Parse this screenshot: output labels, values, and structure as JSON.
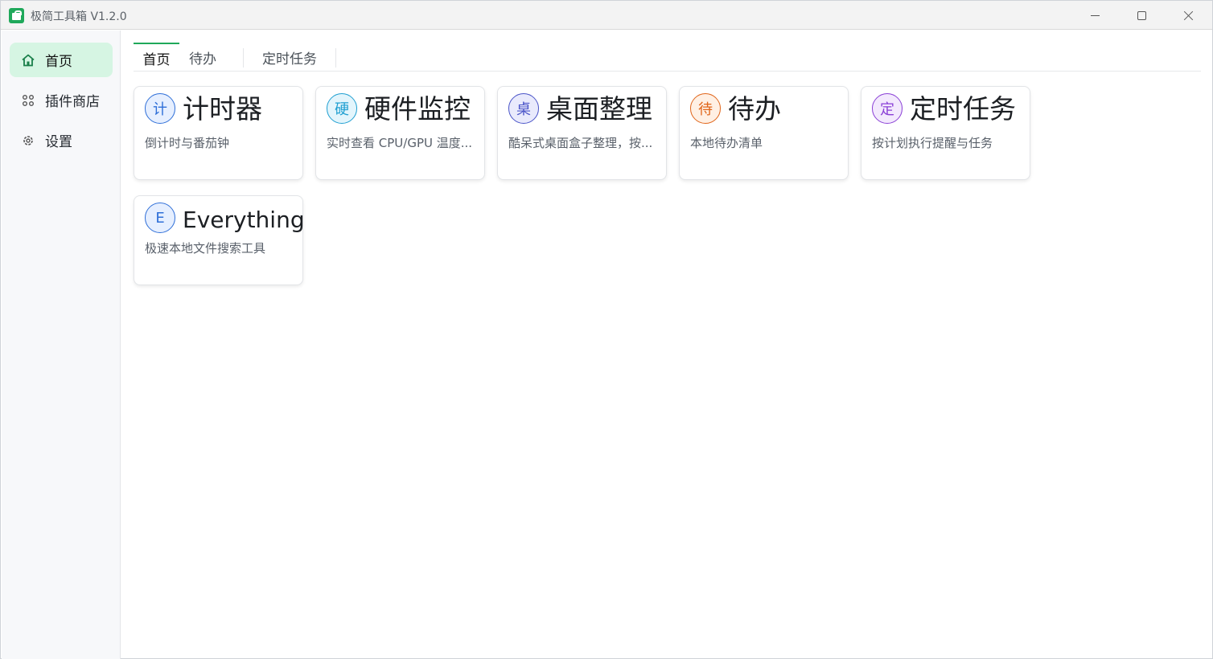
{
  "window": {
    "title": "极简工具箱 V1.2.0"
  },
  "sidebar": {
    "items": [
      {
        "label": "首页",
        "icon": "home-icon",
        "active": true
      },
      {
        "label": "插件商店",
        "icon": "grid-dots-icon",
        "active": false
      },
      {
        "label": "设置",
        "icon": "gear-icon",
        "active": false
      }
    ]
  },
  "tabs": [
    {
      "label": "首页",
      "active": true
    },
    {
      "label": "待办",
      "active": false
    },
    {
      "label": "定时任务",
      "active": false
    }
  ],
  "cards": [
    {
      "badge": "计",
      "title": "计时器",
      "desc": "倒计时与番茄钟",
      "badge_color": "#2f6fd8",
      "badge_bg": "#e6efff"
    },
    {
      "badge": "硬",
      "title": "硬件监控",
      "desc": "实时查看 CPU/GPU 温度...",
      "badge_color": "#1f9fd1",
      "badge_bg": "#e3f5fc"
    },
    {
      "badge": "桌",
      "title": "桌面整理",
      "desc": "酷呆式桌面盒子整理，按...",
      "badge_color": "#4a54c8",
      "badge_bg": "#e9eafc"
    },
    {
      "badge": "待",
      "title": "待办",
      "desc": "本地待办清单",
      "badge_color": "#e0651a",
      "badge_bg": "#fff0e4"
    },
    {
      "badge": "定",
      "title": "定时任务",
      "desc": "按计划执行提醒与任务",
      "badge_color": "#8a3fd6",
      "badge_bg": "#f3e9fd"
    },
    {
      "badge": "E",
      "title": "Everything",
      "desc": "极速本地文件搜索工具",
      "badge_color": "#2f6fd8",
      "badge_bg": "#e6efff"
    }
  ],
  "colors": {
    "accent": "#1fa85a",
    "active_nav_bg": "#d6f5e3"
  }
}
